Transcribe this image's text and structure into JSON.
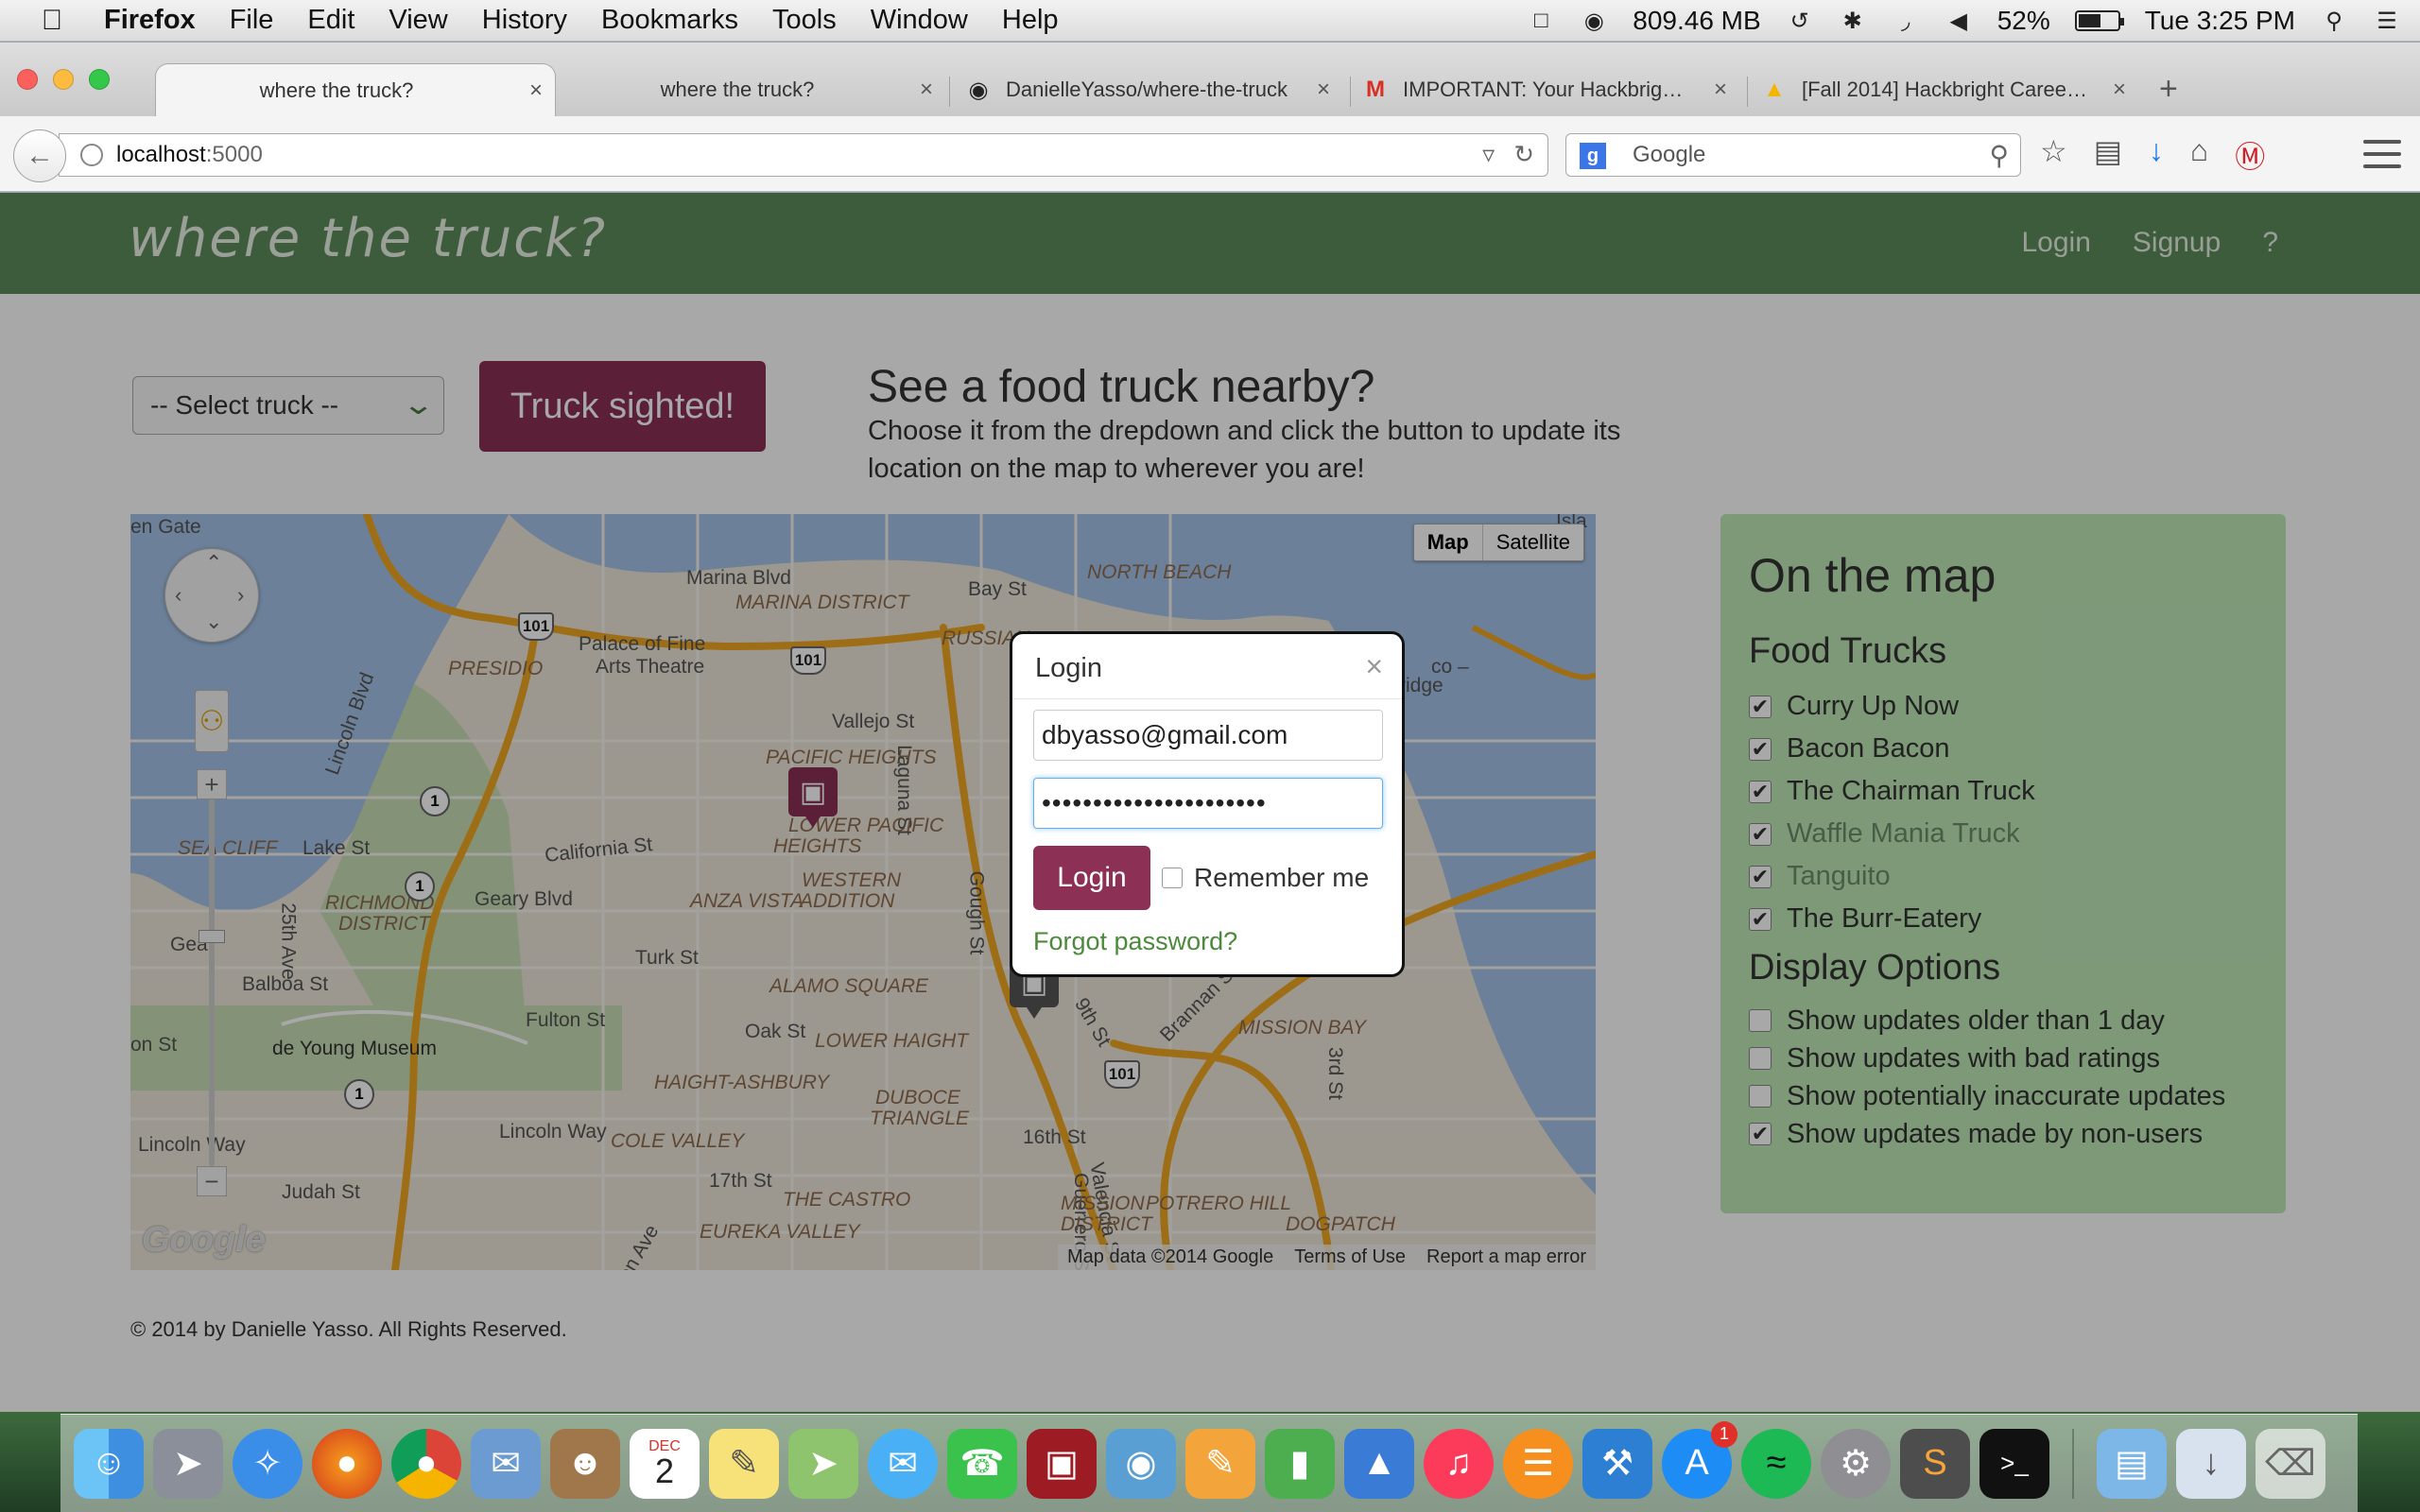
{
  "menubar": {
    "app_name": "Firefox",
    "menus": [
      "File",
      "Edit",
      "View",
      "History",
      "Bookmarks",
      "Tools",
      "Window",
      "Help"
    ],
    "memory": "809.46 MB",
    "battery": "52%",
    "battery_level": 0.52,
    "clock": "Tue 3:25 PM"
  },
  "tabs": [
    {
      "title": "where the truck?",
      "active": true
    },
    {
      "title": "where the truck?",
      "active": false
    },
    {
      "title": "DanielleYasso/where-the-truck",
      "active": false,
      "icon": "github-icon"
    },
    {
      "title": "IMPORTANT: Your Hackbrig…",
      "active": false,
      "icon": "gmail-icon"
    },
    {
      "title": "[Fall 2014] Hackbright Caree…",
      "active": false,
      "icon": "drive-icon"
    }
  ],
  "navbar": {
    "url_host": "localhost",
    "url_port": ":5000",
    "search_placeholder": "Google"
  },
  "site": {
    "brand": "where the truck?",
    "nav_links": [
      "Login",
      "Signup",
      "?"
    ],
    "select_truck": "-- Select truck --",
    "sighted_button": "Truck sighted!",
    "promo_heading": "See a food truck nearby?",
    "promo_text": "Choose it from the drepdown and click the button to update its location on the map to wherever you are!",
    "footer": "© 2014 by Danielle Yasso. All Rights Reserved."
  },
  "map": {
    "type_map": "Map",
    "type_satellite": "Satellite",
    "attribution": "Map data ©2014 Google",
    "terms": "Terms of Use",
    "report": "Report a map error",
    "watermark": "Google",
    "labels": {
      "golden_gate": "en Gate",
      "marina_blvd": "Marina Blvd",
      "marina_district": "MARINA DISTRICT",
      "bay_st": "Bay St",
      "north_beach": "NORTH BEACH",
      "palace": "Palace of Fine",
      "palace2": "Arts Theatre",
      "presidio": "PRESIDIO",
      "russian": "RUSSIAN",
      "lincoln_blvd": "Lincoln Blvd",
      "vallejo": "Vallejo St",
      "pacific_heights": "PACIFIC HEIGHTS",
      "laguna": "Laguna St",
      "lower_pacific": "LOWER PACIFIC",
      "lower_pacific2": "HEIGHTS",
      "sea_cliff": "SEA CLIFF",
      "lake_st": "Lake St",
      "california": "California St",
      "richmond": "RICHMOND",
      "richmond2": "DISTRICT",
      "geary": "Geary Blvd",
      "anza": "ANZA VISTA",
      "western": "WESTERN",
      "western2": "ADDITION",
      "gough": "Gough St",
      "ave25": "25th Ave",
      "balboa": "Balboa St",
      "turk": "Turk St",
      "alamo": "ALAMO SQUARE",
      "fulton": "Fulton St",
      "on_st": "on St",
      "geary_blvd_w": "Gea",
      "deyoung": "de Young Museum",
      "oak": "Oak St",
      "lower_haight": "LOWER HAIGHT",
      "haight": "HAIGHT-ASHBURY",
      "duboce": "DUBOCE",
      "duboce2": "TRIANGLE",
      "ninth": "9th St",
      "brannan": "Brannan St",
      "mission_bay": "MISSION BAY",
      "third": "3rd St",
      "lincoln_way": "Lincoln Way",
      "lincoln_way_w": "Lincoln Way",
      "judah": "Judah St",
      "cole": "COLE VALLEY",
      "seventeenth": "17th St",
      "sixteenth": "16th St",
      "castro": "THE CASTRO",
      "eureka": "EUREKA VALLEY",
      "guerrero": "Guerrero St",
      "valencia": "Valencia St",
      "mission": "MISSION",
      "mission2": "DISTRICT",
      "potrero": "POTRERO HILL",
      "dogpatch": "DOGPATCH",
      "ridge": "ridge",
      "isla": "Isla",
      "co": "co –",
      "on_ave": "on Ave"
    }
  },
  "panel": {
    "title": "On the map",
    "trucks_heading": "Food Trucks",
    "trucks": [
      {
        "name": "Curry Up Now",
        "checked": true,
        "muted": false
      },
      {
        "name": "Bacon Bacon",
        "checked": true,
        "muted": false
      },
      {
        "name": "The Chairman Truck",
        "checked": true,
        "muted": false
      },
      {
        "name": "Waffle Mania Truck",
        "checked": true,
        "muted": true
      },
      {
        "name": "Tanguito",
        "checked": true,
        "muted": true
      },
      {
        "name": "The Burr-Eatery",
        "checked": true,
        "muted": false
      }
    ],
    "options_heading": "Display Options",
    "options": [
      {
        "label": "Show updates older than 1 day",
        "checked": false
      },
      {
        "label": "Show updates with bad ratings",
        "checked": false
      },
      {
        "label": "Show potentially inaccurate updates",
        "checked": false
      },
      {
        "label": "Show updates made by non-users",
        "checked": true
      }
    ]
  },
  "modal": {
    "title": "Login",
    "email": "dbyasso@gmail.com",
    "password": "••••••••••••••••••••••",
    "login_button": "Login",
    "remember": "Remember me",
    "forgot": "Forgot password?"
  },
  "dock": {
    "apps": [
      "finder",
      "launchpad",
      "safari",
      "firefox",
      "chrome",
      "mail",
      "contacts",
      "calendar",
      "notes",
      "maps",
      "messages",
      "facetime",
      "photo-booth",
      "iphoto",
      "pages",
      "numbers",
      "keynote",
      "itunes",
      "ibooks",
      "xcode",
      "app-store",
      "spotify",
      "system-preferences",
      "sublime-text",
      "terminal",
      "documents",
      "downloads",
      "trash"
    ],
    "calendar_month": "DEC",
    "calendar_day": "2",
    "app_store_badge": "1"
  },
  "colors": {
    "brand_green": "#5b8c5a",
    "accent_maroon": "#8c3056",
    "panel_green": "#bfe8b7"
  }
}
